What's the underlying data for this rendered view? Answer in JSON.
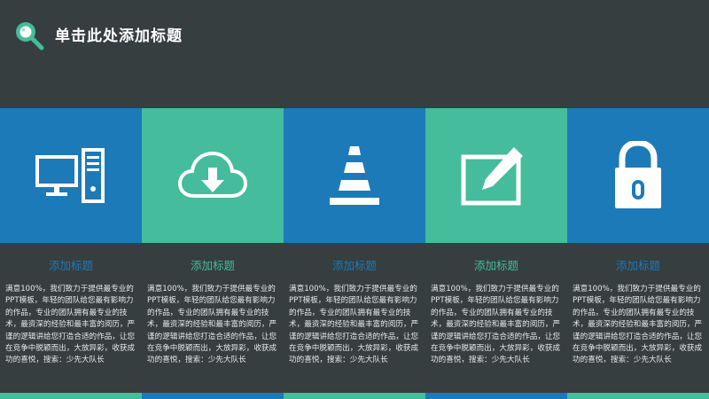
{
  "header": {
    "title": "单击此处添加标题",
    "logo_icon": "magnifier-icon"
  },
  "colors": {
    "background": "#363e3f",
    "blue": "#1d7ab8",
    "teal": "#45bc9c",
    "white": "#ffffff"
  },
  "tiles": [
    {
      "icon": "computer-icon",
      "color": "#1d7ab8"
    },
    {
      "icon": "cloud-download-icon",
      "color": "#45bc9c"
    },
    {
      "icon": "traffic-cone-icon",
      "color": "#1d7ab8"
    },
    {
      "icon": "edit-pencil-icon",
      "color": "#45bc9c"
    },
    {
      "icon": "padlock-icon",
      "color": "#1d7ab8"
    }
  ],
  "columns": [
    {
      "title": "添加标题",
      "title_color": "#1d7ab8",
      "body": "满意100%，我们致力于提供最专业的PPT模板，年轻的团队给您最有影响力的作品，专业的团队拥有最专业的技术，最资深的经验和最丰富的阅历，严谨的逻辑讲给您打造合适的作品，让您在竞争中脱颖而出，大放异彩，收获成功的喜悦，搜索：少先大队长"
    },
    {
      "title": "添加标题",
      "title_color": "#45bc9c",
      "body": "满意100%，我们致力于提供最专业的PPT模板，年轻的团队给您最有影响力的作品，专业的团队拥有最专业的技术，最资深的经验和最丰富的阅历，严谨的逻辑讲给您打造合适的作品，让您在竞争中脱颖而出，大放异彩，收获成功的喜悦，搜索：少先大队长"
    },
    {
      "title": "添加标题",
      "title_color": "#1d7ab8",
      "body": "满意100%，我们致力于提供最专业的PPT模板，年轻的团队给您最有影响力的作品，专业的团队拥有最专业的技术，最资深的经验和最丰富的阅历，严谨的逻辑讲给您打造合适的作品，让您在竞争中脱颖而出，大放异彩，收获成功的喜悦，搜索：少先大队长"
    },
    {
      "title": "添加标题",
      "title_color": "#45bc9c",
      "body": "满意100%，我们致力于提供最专业的PPT模板，年轻的团队给您最有影响力的作品，专业的团队拥有最专业的技术，最资深的经验和最丰富的阅历，严谨的逻辑讲给您打造合适的作品，让您在竞争中脱颖而出，大放异彩，收获成功的喜悦，搜索：少先大队长"
    },
    {
      "title": "添加标题",
      "title_color": "#1d7ab8",
      "body": "满意100%，我们致力于提供最专业的PPT模板，年轻的团队给您最有影响力的作品，专业的团队拥有最专业的技术，最资深的经验和最丰富的阅历，严谨的逻辑讲给您打造合适的作品，让您在竞争中脱颖而出，大放异彩，收获成功的喜悦，搜索：少先大队长"
    }
  ],
  "footer_colors": [
    "#45bc9c",
    "#1d7ab8",
    "#45bc9c",
    "#1d7ab8",
    "#45bc9c"
  ]
}
